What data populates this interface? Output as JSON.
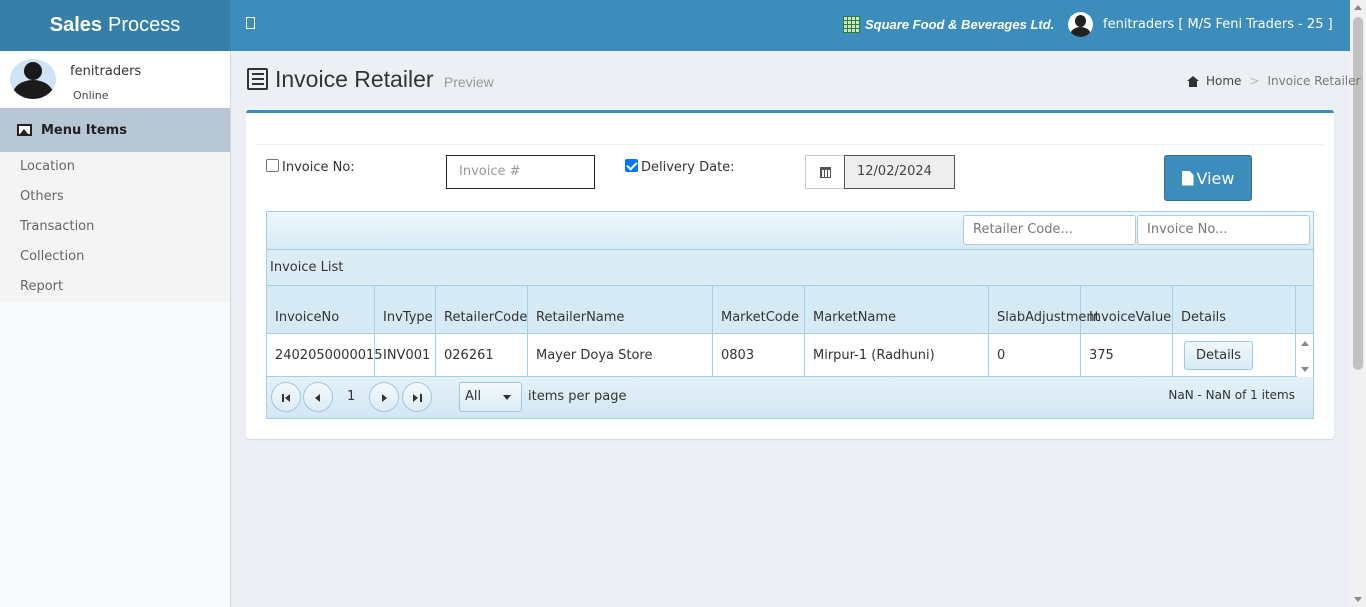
{
  "header": {
    "brand_bold": "Sales",
    "brand_rest": "Process",
    "company": "Square Food & Beverages Ltd.",
    "user": "fenitraders [ M/S Feni Traders - 25 ]",
    "accent_color": "#3c8dbc"
  },
  "sidebar": {
    "user_name": "fenitraders",
    "status": "Online",
    "menu_header": "Menu Items",
    "items": [
      {
        "label": "Location"
      },
      {
        "label": "Others"
      },
      {
        "label": "Transaction"
      },
      {
        "label": "Collection"
      },
      {
        "label": "Report"
      }
    ]
  },
  "page": {
    "title": "Invoice Retailer",
    "subtitle": "Preview",
    "breadcrumb_home": "Home",
    "breadcrumb_sep": ">",
    "breadcrumb_current": "Invoice Retailer"
  },
  "filters": {
    "invoice_no_label": "Invoice No:",
    "invoice_no_checked": false,
    "invoice_placeholder": "Invoice #",
    "delivery_label": "Delivery Date:",
    "delivery_checked": true,
    "delivery_date": "12/02/2024",
    "view_label": "View"
  },
  "grid": {
    "retailer_code_placeholder": "Retailer Code...",
    "invoice_no_placeholder": "Invoice No...",
    "title": "Invoice List",
    "columns": [
      {
        "line1": "Invoice",
        "line2": "No"
      },
      {
        "line1": "Inv",
        "line2": "Type"
      },
      {
        "line1": "Retailer",
        "line2": "Code"
      },
      {
        "line1": "",
        "line2": "RetailerName"
      },
      {
        "line1": "Market",
        "line2": "Code"
      },
      {
        "line1": "Market",
        "line2": "Name"
      },
      {
        "line1": "Slab",
        "line2": "Adjustment"
      },
      {
        "line1": "Invoice",
        "line2": "Value"
      },
      {
        "line1": "",
        "line2": "Details"
      }
    ],
    "rows": [
      {
        "invoice_no": "2402050000015",
        "inv_type": "INV001",
        "retailer_code": "026261",
        "retailer_name": "Mayer Doya Store",
        "market_code": "0803",
        "market_name": "Mirpur-1 (Radhuni)",
        "slab_adjustment": "0",
        "invoice_value": "375",
        "details_label": "Details"
      }
    ],
    "pager": {
      "page": "1",
      "page_size": "All",
      "items_per_page_label": "items per page",
      "info": "NaN - NaN of 1 items"
    }
  }
}
